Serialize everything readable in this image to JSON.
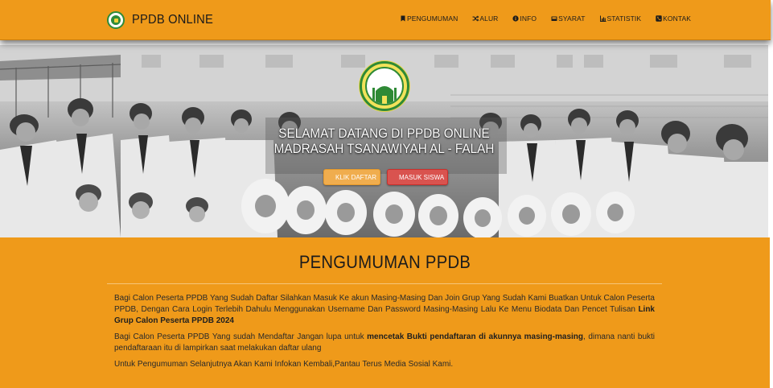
{
  "brand": {
    "name": "PPDB ONLINE",
    "logo_icon": "school-logo-icon"
  },
  "nav": {
    "items": [
      {
        "label": "PENGUMUMAN",
        "icon": "bookmark-icon"
      },
      {
        "label": "ALUR",
        "icon": "shuffle-icon"
      },
      {
        "label": "INFO",
        "icon": "info-icon"
      },
      {
        "label": "SYARAT",
        "icon": "inbox-icon"
      },
      {
        "label": "STATISTIK",
        "icon": "bar-chart-icon"
      },
      {
        "label": "KONTAK",
        "icon": "phone-icon"
      }
    ]
  },
  "hero": {
    "title_line1": "SELAMAT DATANG DI PPDB ONLINE",
    "title_line2": "MADRASAH TSANAWIYAH AL - FALAH",
    "logo_icon": "madrasah-emblem-icon",
    "btn_daftar": "KLIK DAFTAR",
    "btn_masuk": "MASUK SISWA"
  },
  "announcement": {
    "title": "PENGUMUMAN PPDB",
    "p1_text": "Bagi Calon Peserta PPDB Yang Sudah Daftar Silahkan Masuk Ke akun Masing-Masing Dan Join Grup Yang Sudah Kami Buatkan Untuk Calon Peserta PPDB, Dengan Cara Login Terlebih Dahulu Menggunakan Username Dan Password Masing-Masing Lalu Ke Menu Biodata Dan Pencet Tulisan ",
    "p1_link": "Link Grup Calon Peserta PPDB 2024",
    "p2_text_a": "Bagi Calon Peserta PPDB Yang sudah Mendaftar Jangan lupa untuk ",
    "p2_strong": "mencetak Bukti pendaftaran di akunnya masing-masing",
    "p2_text_b": ", dimana nanti bukti pendaftaraan itu di lampirkan saat melakukan daftar ulang",
    "p3_text": "Untuk Pengumuman Selanjutnya Akan Kami Infokan Kembali,Pantau Terus Media Sosial Kami."
  },
  "colors": {
    "accent_orange": "#ef9a1a",
    "btn_warning": "#f0ad4e",
    "btn_danger": "#d9534f",
    "emblem_green": "#2f8a36"
  }
}
